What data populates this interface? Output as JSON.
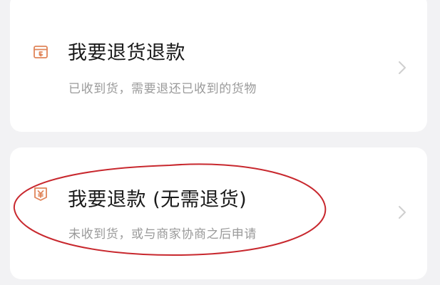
{
  "colors": {
    "icon_accent": "#e0855a",
    "title": "#1a1a1a",
    "subtitle": "#9a9a9a",
    "chevron": "#cfcfcf",
    "annotation": "#c8282e"
  },
  "options": [
    {
      "icon": "return-box-icon",
      "title": "我要退货退款",
      "subtitle": "已收到货，需要退还已收到的货物"
    },
    {
      "icon": "yuan-refund-icon",
      "title": "我要退款 (无需退货)",
      "subtitle": "未收到货，或与商家协商之后申请"
    }
  ]
}
